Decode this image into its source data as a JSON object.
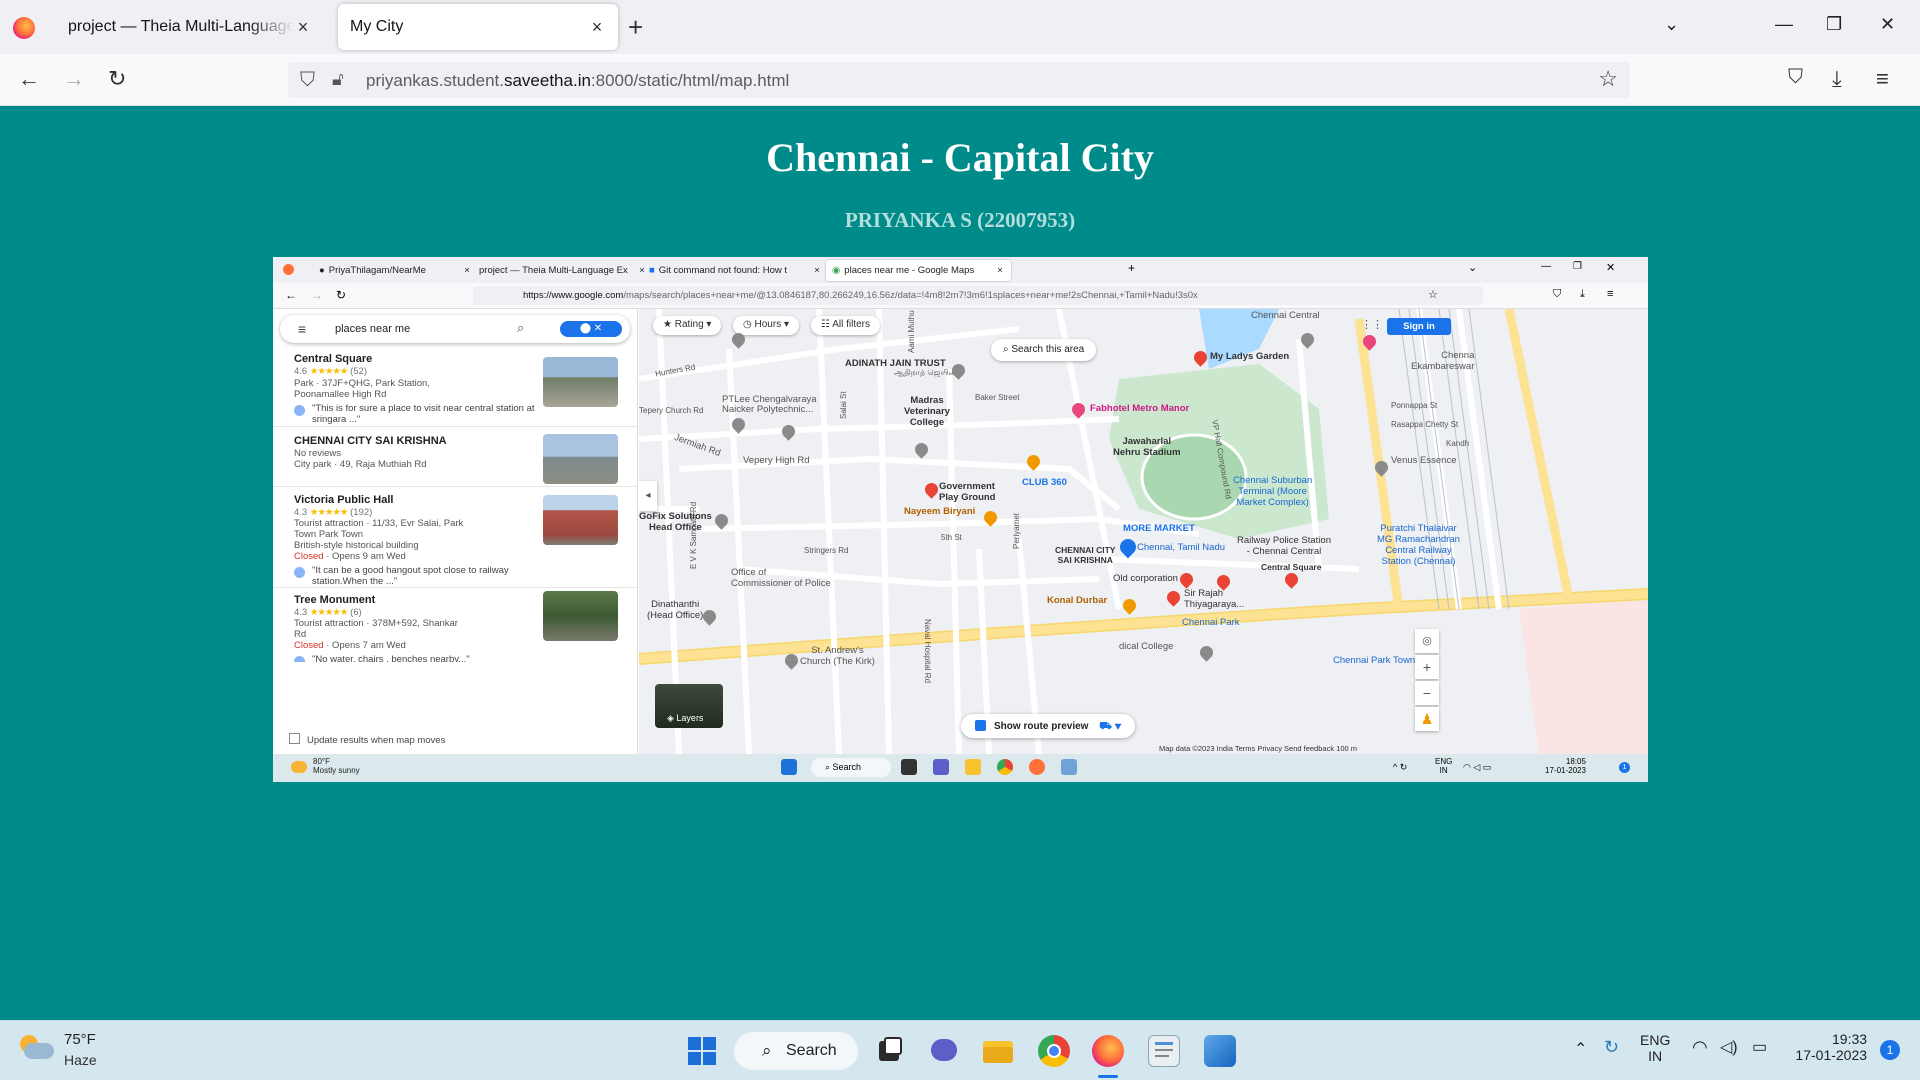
{
  "browser": {
    "tabs": [
      {
        "title": "project — Theia Multi-Language Ex",
        "active": false
      },
      {
        "title": "My City",
        "active": true
      }
    ],
    "url_prefix": "priyankas.student.",
    "url_domain": "saveetha.in",
    "url_suffix": ":8000/static/html/map.html"
  },
  "page": {
    "title": "Chennai - Capital City",
    "subtitle": "PRIYANKA S (22007953)",
    "background": "#008b8b"
  },
  "embedded": {
    "tabs": [
      {
        "title": "PriyaThilagam/NearMe"
      },
      {
        "title": "project — Theia Multi-Language Ex"
      },
      {
        "title": "Git command not found: How t"
      },
      {
        "title": "places near me - Google Maps"
      }
    ],
    "url_domain": "https://www.google.com",
    "url_rest": "/maps/search/places+near+me/@13.0846187,80.266249,16.56z/data=!4m8!2m7!3m6!1splaces+near+me!2sChennai,+Tamil+Nadu!3s0x",
    "search_query": "places near me",
    "results": [
      {
        "name": "Central Square",
        "rating": "4.6",
        "stars": "★★★★★",
        "count": "(52)",
        "line1": "Park · 37JF+QHG, Park Station,",
        "line2": "Poonamallee High Rd",
        "review1": "\"This is for sure a place to visit near central station at",
        "review2": "sringara ...\""
      },
      {
        "name": "CHENNAI CITY SAI KRISHNA",
        "rating_text": "No reviews",
        "line1": "City park · 49, Raja Muthiah Rd"
      },
      {
        "name": "Victoria Public Hall",
        "rating": "4.3",
        "stars": "★★★★★",
        "count": "(192)",
        "line1": "Tourist attraction · 11/33, Evr Salai, Park",
        "line2": "Town Park Town",
        "line3": "British-style historical building",
        "closed": "Closed",
        "hours": " · Opens 9 am Wed",
        "review1": "\"It can be a good hangout spot close to railway",
        "review2": "station.When the ...\""
      },
      {
        "name": "Tree Monument",
        "rating": "4.3",
        "stars": "★★★★★",
        "count": "(6)",
        "line1": "Tourist attraction · 378M+592, Shankar",
        "line2": "Rd",
        "closed": "Closed",
        "hours": " · Opens 7 am Wed",
        "review1": "\"No water, chairs , benches nearby...\""
      }
    ],
    "update_label": "Update results when map moves",
    "chips": [
      "Rating",
      "Hours",
      "All filters"
    ],
    "search_area": "Search this area",
    "sign_in": "Sign in",
    "route_preview": "Show route preview",
    "layers": "Layers",
    "map_footer": "Map data ©2023    India    Terms    Privacy    Send feedback    100 m",
    "map_labels": {
      "adinath": "ADINATH JAIN TRUST",
      "adinath_ta": "ஆதிநாத் ஜெயின்",
      "hunters": "Hunters Rd",
      "ptlee": "PTLee Chengalvaraya",
      "ptlee2": "Naicker Polytechnic...",
      "tepery": "Tepery Church Rd",
      "madras_vet": "Madras",
      "madras_vet2": "Veterinary",
      "madras_vet3": "College",
      "baker": "Baker Street",
      "fabhotel": "Fabhotel Metro Manor",
      "mylady": "My Ladys Garden",
      "jawaharlal": "Jawaharlal",
      "nehru": "Nehru Stadium",
      "vepery": "Vepery High Rd",
      "jermiah": "Jermiah Rd",
      "club360": "CLUB 360",
      "govt": "Government",
      "govt2": "Play Ground",
      "nayeem": "Nayeem Biryani",
      "gofix": "GoFix Solutions",
      "gofix2": "Head Office",
      "fifth": "5th St",
      "stringers": "Stringers Rd",
      "more": "MORE MARKET",
      "csk": "CHENNAI CITY",
      "csk2": "SAI KRISHNA",
      "chennai_tn": "Chennai, Tamil Nadu",
      "commissioner": "Office of",
      "commissioner2": "Commissioner of Police",
      "old_corp": "Old corporation",
      "sir_rajah": "Sir Rajah",
      "sir_rajah2": "Thiyagaraya...",
      "konal": "Konal Durbar",
      "dinathanthi": "Dinathanthi",
      "dinathanthi2": "(Head Office)",
      "st_andrews": "St. Andrew's",
      "st_andrews2": "Church (The Kirk)",
      "chennai_park": "Chennai Park",
      "medical": "dical College",
      "chennai_suburban": "Chennai Suburban",
      "chennai_suburban2": "Terminal (Moore",
      "chennai_suburban3": "Market Complex)",
      "railway_police": "Railway Police Station",
      "railway_police2": "- Chennai Central",
      "central_square": "Central Square",
      "puratchi": "Puratchi Thalaivar",
      "puratchi2": "MG Ramachandran",
      "puratchi3": "Central Railway",
      "puratchi4": "Station (Chennai)",
      "venus": "Venus Essence",
      "chennai_central": "Chennai Central",
      "chennai_park_town": "Chennai Park Town",
      "ekambar": "Chenna",
      "ekambar2": "Ekambareswar",
      "ponnappa": "Ponnappa St",
      "rasappa": "Rasappa Chetty St",
      "kandh": "Kandh",
      "ev_sampath": "E V K Sampath Rd",
      "salai": "Salai St",
      "naval": "Naval Hospital Rd",
      "vp_hall": "VP Hall Compound Rd",
      "periyar": "Periyamet",
      "sai_mathu": "Aami Muthu St"
    },
    "weather_small": "80°F",
    "weather_small2": "Mostly sunny",
    "search_small": "Search",
    "lang_small": "ENG",
    "lang_small2": "IN",
    "time_small": "18:05",
    "date_small": "17-01-2023"
  },
  "taskbar": {
    "weather_temp": "75°F",
    "weather_desc": "Haze",
    "search": "Search",
    "lang": "ENG",
    "region": "IN",
    "time": "19:33",
    "date": "17-01-2023",
    "notif_count": "1"
  }
}
